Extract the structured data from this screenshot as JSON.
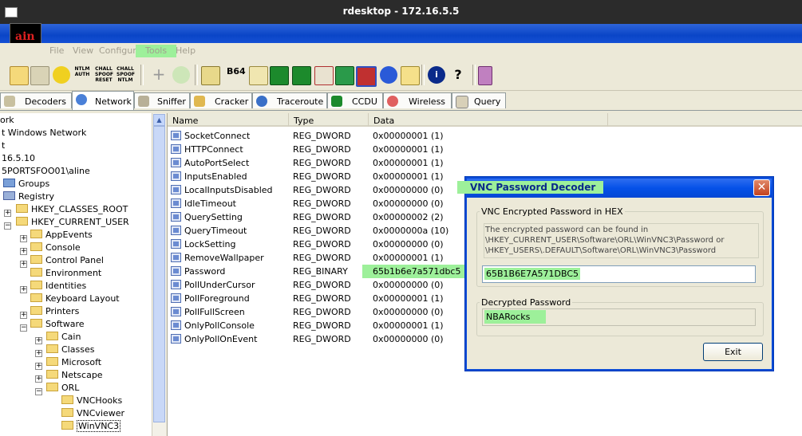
{
  "outer_window": {
    "title": "rdesktop - 172.16.5.5"
  },
  "app": {
    "logo_text": "ain"
  },
  "menu": [
    "File",
    "View",
    "Configure",
    "Tools",
    "Help"
  ],
  "toolbar": {
    "ntlm_auth": "NTLM AUTH",
    "chall_spoof_reset": "CHALL SPOOF RESET",
    "chall_spoof_ntlm": "CHALL SPOOF NTLM",
    "b64": "B64"
  },
  "tabs": [
    "Decoders",
    "Network",
    "Sniffer",
    "Cracker",
    "Traceroute",
    "CCDU",
    "Wireless",
    "Query"
  ],
  "tree": [
    "ork",
    "t Windows Network",
    "t",
    "16.5.10",
    "5PORTSFOO01\\aline",
    "Groups",
    "Registry",
    "HKEY_CLASSES_ROOT",
    "HKEY_CURRENT_USER",
    "AppEvents",
    "Console",
    "Control Panel",
    "Environment",
    "Identities",
    "Keyboard Layout",
    "Printers",
    "Software",
    "Cain",
    "Classes",
    "Microsoft",
    "Netscape",
    "ORL",
    "VNCHooks",
    "VNCviewer",
    "WinVNC3"
  ],
  "list": {
    "headers": [
      "Name",
      "Type",
      "Data"
    ],
    "rows": [
      {
        "name": "SocketConnect",
        "type": "REG_DWORD",
        "data": "0x00000001 (1)"
      },
      {
        "name": "HTTPConnect",
        "type": "REG_DWORD",
        "data": "0x00000001 (1)"
      },
      {
        "name": "AutoPortSelect",
        "type": "REG_DWORD",
        "data": "0x00000001 (1)"
      },
      {
        "name": "InputsEnabled",
        "type": "REG_DWORD",
        "data": "0x00000001 (1)"
      },
      {
        "name": "LocalInputsDisabled",
        "type": "REG_DWORD",
        "data": "0x00000000 (0)"
      },
      {
        "name": "IdleTimeout",
        "type": "REG_DWORD",
        "data": "0x00000000 (0)"
      },
      {
        "name": "QuerySetting",
        "type": "REG_DWORD",
        "data": "0x00000002 (2)"
      },
      {
        "name": "QueryTimeout",
        "type": "REG_DWORD",
        "data": "0x0000000a (10)"
      },
      {
        "name": "LockSetting",
        "type": "REG_DWORD",
        "data": "0x00000000 (0)"
      },
      {
        "name": "RemoveWallpaper",
        "type": "REG_DWORD",
        "data": "0x00000001 (1)"
      },
      {
        "name": "Password",
        "type": "REG_BINARY",
        "data": "65b1b6e7a571dbc5"
      },
      {
        "name": "PollUnderCursor",
        "type": "REG_DWORD",
        "data": "0x00000000 (0)"
      },
      {
        "name": "PollForeground",
        "type": "REG_DWORD",
        "data": "0x00000001 (1)"
      },
      {
        "name": "PollFullScreen",
        "type": "REG_DWORD",
        "data": "0x00000000 (0)"
      },
      {
        "name": "OnlyPollConsole",
        "type": "REG_DWORD",
        "data": "0x00000001 (1)"
      },
      {
        "name": "OnlyPollOnEvent",
        "type": "REG_DWORD",
        "data": "0x00000000 (0)"
      }
    ]
  },
  "dialog": {
    "title": "VNC Password Decoder",
    "encrypted_group": "VNC Encrypted Password in HEX",
    "info_line1": "The encrypted password can be found in",
    "info_line2": "\\HKEY_CURRENT_USER\\Software\\ORL\\WinVNC3\\Password or",
    "info_line3": "\\HKEY_USERS\\.DEFAULT\\Software\\ORL\\WinVNC3\\Password",
    "encrypted_value": "65B1B6E7A571DBC5",
    "decrypted_group": "Decrypted Password",
    "decrypted_value": "NBARocks",
    "exit_label": "Exit"
  },
  "colors": {
    "highlight": "#9df09a",
    "xp_blue": "#0a45c7"
  }
}
